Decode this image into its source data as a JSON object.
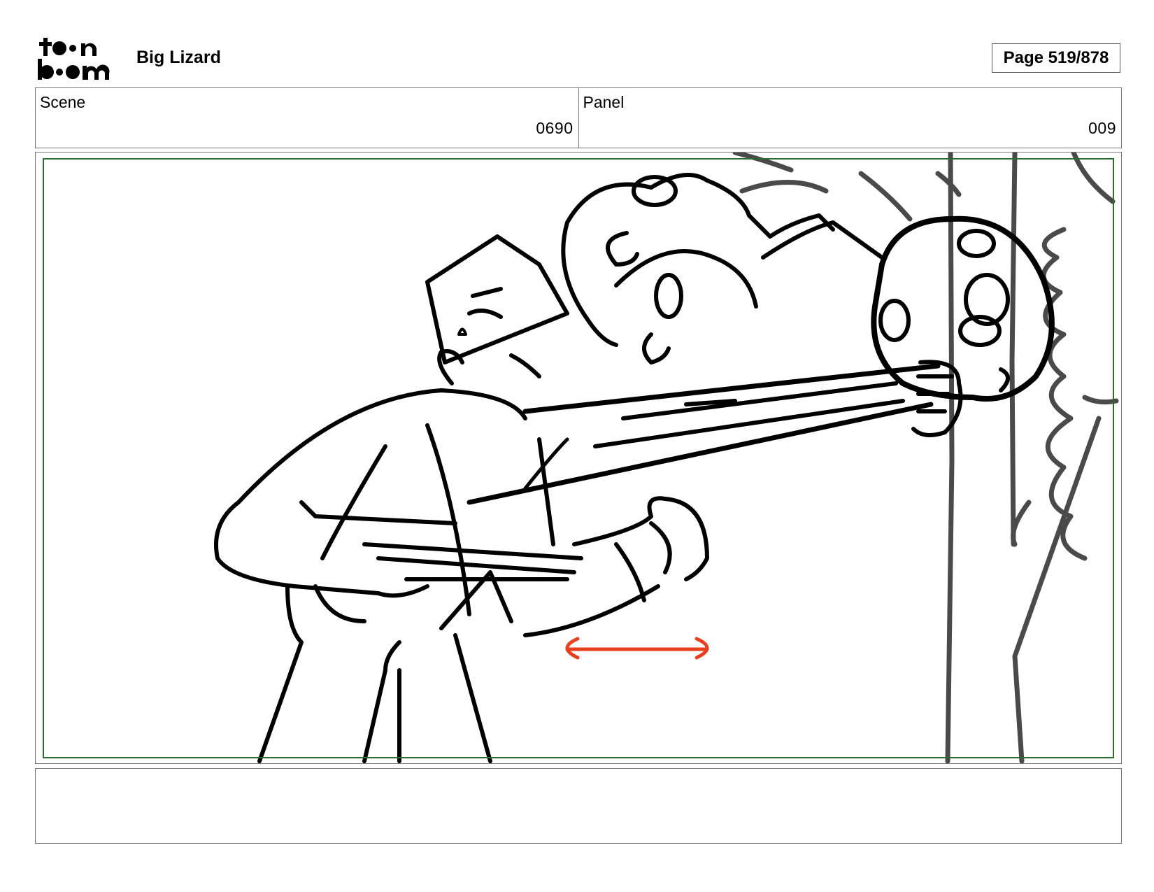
{
  "header": {
    "logo": {
      "line1": "toon",
      "line2": "boom"
    },
    "project_title": "Big Lizard",
    "page_label": "Page 519/878"
  },
  "info": {
    "scene_label": "Scene",
    "scene_value": "0690",
    "panel_label": "Panel",
    "panel_value": "009"
  },
  "panel": {
    "safe_area_color": "#2e6b2e",
    "motion_arrow_color": "#e8401c"
  },
  "notes": {
    "text": ""
  }
}
